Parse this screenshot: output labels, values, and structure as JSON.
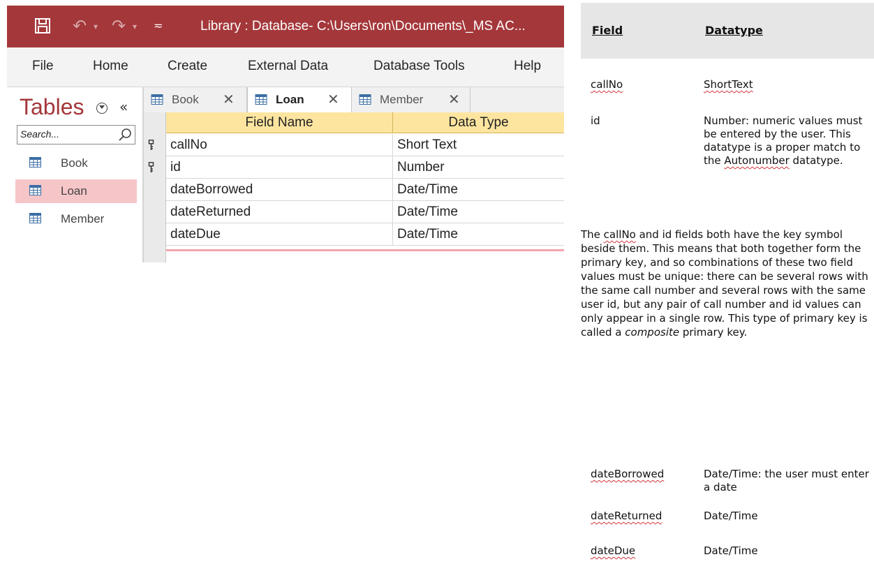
{
  "titlebar": {
    "title": "Library : Database- C:\\Users\\ron\\Documents\\_MS AC...",
    "icons": [
      "save-icon",
      "undo-icon",
      "redo-icon",
      "customize-quick-access-icon"
    ]
  },
  "ribbon": {
    "tabs": [
      "File",
      "Home",
      "Create",
      "External Data",
      "Database Tools",
      "Help"
    ]
  },
  "nav": {
    "title": "Tables",
    "search_placeholder": "Search...",
    "items": [
      {
        "label": "Book",
        "selected": false
      },
      {
        "label": "Loan",
        "selected": true
      },
      {
        "label": "Member",
        "selected": false
      }
    ]
  },
  "object_tabs": [
    {
      "label": "Book",
      "active": false
    },
    {
      "label": "Loan",
      "active": true
    },
    {
      "label": "Member",
      "active": false
    }
  ],
  "grid": {
    "headers": [
      "Field Name",
      "Data Type"
    ],
    "rows": [
      {
        "field": "callNo",
        "type": "Short Text",
        "primary_key": true
      },
      {
        "field": "id",
        "type": "Number",
        "primary_key": true
      },
      {
        "field": "dateBorrowed",
        "type": "Date/Time",
        "primary_key": false
      },
      {
        "field": "dateReturned",
        "type": "Date/Time",
        "primary_key": false
      },
      {
        "field": "dateDue",
        "type": "Date/Time",
        "primary_key": false
      }
    ]
  },
  "doc": {
    "header_field": "Field",
    "header_datatype": "Datatype",
    "entries": [
      {
        "field": "callNo",
        "desc": "ShortText"
      },
      {
        "field": "id",
        "desc_pre": "Number: numeric values must be entered by the user. This datatype is a proper match to the ",
        "desc_err": "Autonumber",
        "desc_post": " datatype."
      },
      {
        "field": "dateBorrowed",
        "desc": "Date/Time: the user must enter a date"
      },
      {
        "field": "dateReturned",
        "desc": "Date/Time"
      },
      {
        "field": "dateDue",
        "desc": "Date/Time"
      }
    ],
    "paragraph": {
      "p1": "The ",
      "p_err": "callNo",
      "p2": " and id fields both have the key symbol beside them. This means that both together form the primary key, and so combinations of these two field values must be unique: there can be several rows with the same call number and several rows with the same user id, but any pair of call number and id values can only appear in a single row. This type of primary key is called a ",
      "p_em": "composite",
      "p3": " primary key."
    }
  },
  "colors": {
    "access_red": "#a4373a",
    "selected_nav": "#f6c5c8",
    "grid_header": "#fde5a0",
    "spell_error": "#d13438"
  }
}
